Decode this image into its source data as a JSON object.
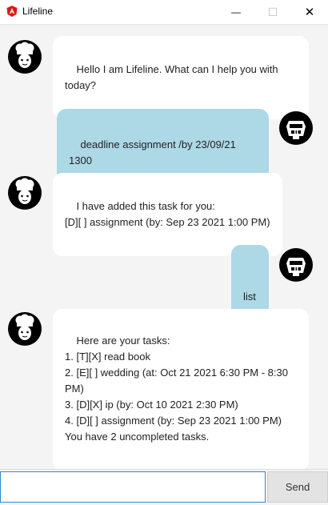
{
  "window": {
    "title": "Lifeline",
    "min_glyph": "—",
    "max_glyph": "☐",
    "close_glyph": "✕"
  },
  "messages": [
    {
      "sender": "bot",
      "text": "Hello I am Lifeline. What can I help you with\ntoday?"
    },
    {
      "sender": "user",
      "text": "deadline assignment /by 23/09/21 1300"
    },
    {
      "sender": "bot",
      "text": "I have added this task for you:\n[D][ ] assignment (by: Sep 23 2021 1:00 PM)"
    },
    {
      "sender": "user",
      "text": "list"
    },
    {
      "sender": "bot",
      "text": "Here are your tasks:\n1. [T][X] read book\n2. [E][ ] wedding (at: Oct 21 2021 6:30 PM - 8:30\nPM)\n3. [D][X] ip (by: Oct 10 2021 2:30 PM)\n4. [D][ ] assignment (by: Sep 23 2021 1:00 PM)\nYou have 2 uncompleted tasks."
    }
  ],
  "input": {
    "value": "",
    "placeholder": ""
  },
  "send_label": "Send",
  "colors": {
    "user_bubble": "#add8e6",
    "bot_bubble": "#ffffff",
    "background": "#f4f4f4",
    "input_focus": "#2a8bd8"
  },
  "icons": {
    "app": "lifeline-app-icon",
    "bot_avatar": "chef-avatar-icon",
    "user_avatar": "robot-avatar-icon"
  }
}
